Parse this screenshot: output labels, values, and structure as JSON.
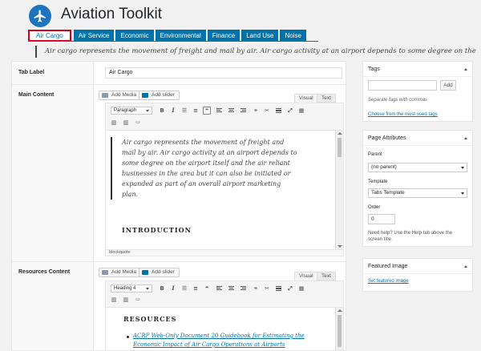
{
  "app": {
    "title": "Aviation Toolkit",
    "logo_color": "#1e73be"
  },
  "tabs": [
    {
      "label": "Air Cargo",
      "active": true
    },
    {
      "label": "Air Service"
    },
    {
      "label": "Economic"
    },
    {
      "label": "Environmental"
    },
    {
      "label": "Finance"
    },
    {
      "label": "Land Use"
    },
    {
      "label": "Noise"
    }
  ],
  "intro_text": "Air cargo represents the movement of freight and mail by air. Air cargo activity at an airport depends to some degree on the",
  "form": {
    "tab_label": {
      "label": "Tab Label",
      "value": "Air Cargo"
    },
    "main_content": {
      "label": "Main Content",
      "add_media": "Add Media",
      "add_slider": "Add slider",
      "visual_tab": "Visual",
      "text_tab": "Text",
      "format": "Paragraph",
      "blockquote_lines": [
        "Air cargo represents the movement of freight and",
        "mail by air. Air cargo activity at an airport depends to",
        "some degree on the airport itself and the air reliant",
        "businesses in the area but it can also be initiated or",
        "expanded as part of an overall airport marketing",
        "plan."
      ],
      "heading": "INTRODUCTION",
      "status_path": "blockquote"
    },
    "resources_content": {
      "label": "Resources Content",
      "add_media": "Add Media",
      "add_slider": "Add slider",
      "visual_tab": "Visual",
      "text_tab": "Text",
      "format": "Heading 4",
      "heading": "RESOURCES",
      "link_lines": [
        "ACRP Web-Only Document 20 Guidebook for Estimating the",
        "Economic Impact of Air Cargo Operations at Airports"
      ]
    }
  },
  "sidebar": {
    "tags": {
      "title": "Tags",
      "add_button": "Add",
      "hint": "Separate tags with commas",
      "link": "Choose from the most used tags"
    },
    "page_attributes": {
      "title": "Page Attributes",
      "parent_label": "Parent",
      "parent_value": "(no parent)",
      "template_label": "Template",
      "template_value": "Tabs Template",
      "order_label": "Order",
      "order_value": "0",
      "help_lines": [
        "Need help? Use the Help tab above the",
        "screen title."
      ]
    },
    "featured_image": {
      "title": "Featured Image",
      "link": "Set featured image"
    }
  }
}
